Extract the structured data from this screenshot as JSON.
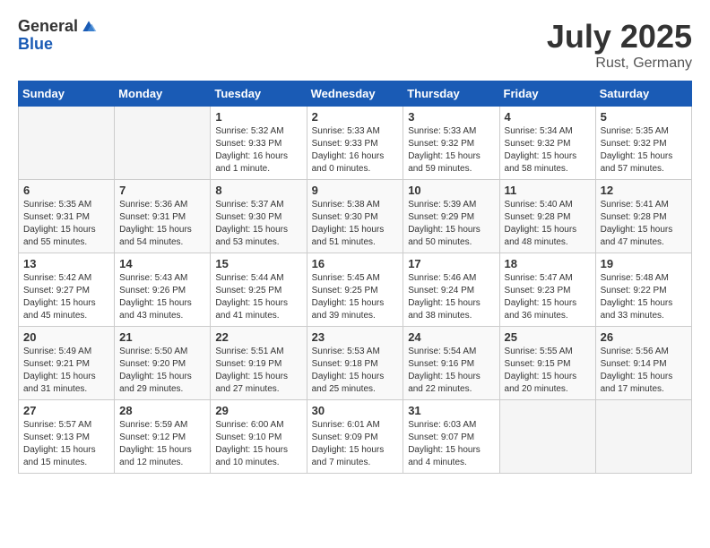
{
  "header": {
    "logo_general": "General",
    "logo_blue": "Blue",
    "month_year": "July 2025",
    "location": "Rust, Germany"
  },
  "days_of_week": [
    "Sunday",
    "Monday",
    "Tuesday",
    "Wednesday",
    "Thursday",
    "Friday",
    "Saturday"
  ],
  "weeks": [
    [
      {
        "day": "",
        "info": ""
      },
      {
        "day": "",
        "info": ""
      },
      {
        "day": "1",
        "info": "Sunrise: 5:32 AM\nSunset: 9:33 PM\nDaylight: 16 hours\nand 1 minute."
      },
      {
        "day": "2",
        "info": "Sunrise: 5:33 AM\nSunset: 9:33 PM\nDaylight: 16 hours\nand 0 minutes."
      },
      {
        "day": "3",
        "info": "Sunrise: 5:33 AM\nSunset: 9:32 PM\nDaylight: 15 hours\nand 59 minutes."
      },
      {
        "day": "4",
        "info": "Sunrise: 5:34 AM\nSunset: 9:32 PM\nDaylight: 15 hours\nand 58 minutes."
      },
      {
        "day": "5",
        "info": "Sunrise: 5:35 AM\nSunset: 9:32 PM\nDaylight: 15 hours\nand 57 minutes."
      }
    ],
    [
      {
        "day": "6",
        "info": "Sunrise: 5:35 AM\nSunset: 9:31 PM\nDaylight: 15 hours\nand 55 minutes."
      },
      {
        "day": "7",
        "info": "Sunrise: 5:36 AM\nSunset: 9:31 PM\nDaylight: 15 hours\nand 54 minutes."
      },
      {
        "day": "8",
        "info": "Sunrise: 5:37 AM\nSunset: 9:30 PM\nDaylight: 15 hours\nand 53 minutes."
      },
      {
        "day": "9",
        "info": "Sunrise: 5:38 AM\nSunset: 9:30 PM\nDaylight: 15 hours\nand 51 minutes."
      },
      {
        "day": "10",
        "info": "Sunrise: 5:39 AM\nSunset: 9:29 PM\nDaylight: 15 hours\nand 50 minutes."
      },
      {
        "day": "11",
        "info": "Sunrise: 5:40 AM\nSunset: 9:28 PM\nDaylight: 15 hours\nand 48 minutes."
      },
      {
        "day": "12",
        "info": "Sunrise: 5:41 AM\nSunset: 9:28 PM\nDaylight: 15 hours\nand 47 minutes."
      }
    ],
    [
      {
        "day": "13",
        "info": "Sunrise: 5:42 AM\nSunset: 9:27 PM\nDaylight: 15 hours\nand 45 minutes."
      },
      {
        "day": "14",
        "info": "Sunrise: 5:43 AM\nSunset: 9:26 PM\nDaylight: 15 hours\nand 43 minutes."
      },
      {
        "day": "15",
        "info": "Sunrise: 5:44 AM\nSunset: 9:25 PM\nDaylight: 15 hours\nand 41 minutes."
      },
      {
        "day": "16",
        "info": "Sunrise: 5:45 AM\nSunset: 9:25 PM\nDaylight: 15 hours\nand 39 minutes."
      },
      {
        "day": "17",
        "info": "Sunrise: 5:46 AM\nSunset: 9:24 PM\nDaylight: 15 hours\nand 38 minutes."
      },
      {
        "day": "18",
        "info": "Sunrise: 5:47 AM\nSunset: 9:23 PM\nDaylight: 15 hours\nand 36 minutes."
      },
      {
        "day": "19",
        "info": "Sunrise: 5:48 AM\nSunset: 9:22 PM\nDaylight: 15 hours\nand 33 minutes."
      }
    ],
    [
      {
        "day": "20",
        "info": "Sunrise: 5:49 AM\nSunset: 9:21 PM\nDaylight: 15 hours\nand 31 minutes."
      },
      {
        "day": "21",
        "info": "Sunrise: 5:50 AM\nSunset: 9:20 PM\nDaylight: 15 hours\nand 29 minutes."
      },
      {
        "day": "22",
        "info": "Sunrise: 5:51 AM\nSunset: 9:19 PM\nDaylight: 15 hours\nand 27 minutes."
      },
      {
        "day": "23",
        "info": "Sunrise: 5:53 AM\nSunset: 9:18 PM\nDaylight: 15 hours\nand 25 minutes."
      },
      {
        "day": "24",
        "info": "Sunrise: 5:54 AM\nSunset: 9:16 PM\nDaylight: 15 hours\nand 22 minutes."
      },
      {
        "day": "25",
        "info": "Sunrise: 5:55 AM\nSunset: 9:15 PM\nDaylight: 15 hours\nand 20 minutes."
      },
      {
        "day": "26",
        "info": "Sunrise: 5:56 AM\nSunset: 9:14 PM\nDaylight: 15 hours\nand 17 minutes."
      }
    ],
    [
      {
        "day": "27",
        "info": "Sunrise: 5:57 AM\nSunset: 9:13 PM\nDaylight: 15 hours\nand 15 minutes."
      },
      {
        "day": "28",
        "info": "Sunrise: 5:59 AM\nSunset: 9:12 PM\nDaylight: 15 hours\nand 12 minutes."
      },
      {
        "day": "29",
        "info": "Sunrise: 6:00 AM\nSunset: 9:10 PM\nDaylight: 15 hours\nand 10 minutes."
      },
      {
        "day": "30",
        "info": "Sunrise: 6:01 AM\nSunset: 9:09 PM\nDaylight: 15 hours\nand 7 minutes."
      },
      {
        "day": "31",
        "info": "Sunrise: 6:03 AM\nSunset: 9:07 PM\nDaylight: 15 hours\nand 4 minutes."
      },
      {
        "day": "",
        "info": ""
      },
      {
        "day": "",
        "info": ""
      }
    ]
  ]
}
